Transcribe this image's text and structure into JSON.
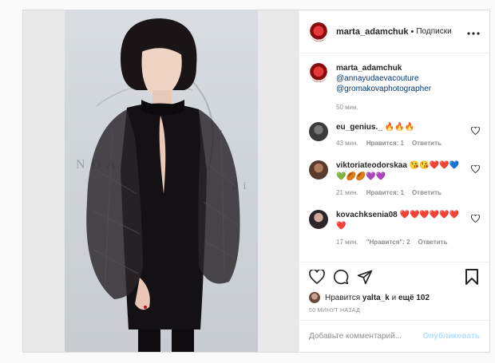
{
  "post": {
    "author": "marta_adamchuk",
    "follow_label": "Подписки",
    "header_separator": "•",
    "more_icon": "more-horizontal-icon",
    "caption": {
      "username": "marta_adamchuk",
      "mention1": "@annayudaevacouture",
      "mention2": "@gromakovaphotographer",
      "time": "50 мин."
    },
    "photo": {
      "wall_text_left": "N D A",
      "wall_text_right": "d i"
    },
    "comments": [
      {
        "username": "eu_genius._",
        "text": "🔥🔥🔥",
        "time": "43 мин.",
        "likes": "Нравится: 1",
        "reply": "Ответить"
      },
      {
        "username": "viktoriateodorskaa",
        "text": "😘😘❤️❤️💙💚🏉🏉💜💜",
        "time": "21 мин.",
        "likes": "Нравится: 1",
        "reply": "Ответить"
      },
      {
        "username": "kovachksenia08",
        "text": "❤️❤️❤️❤️❤️❤️❤️",
        "time": "17 мин.",
        "likes": "\"Нравится\": 2",
        "reply": "Ответить"
      }
    ],
    "likes": {
      "prefix": "Нравится",
      "user": "yalta_k",
      "middle": "и",
      "others": "ещё 102"
    },
    "posted_ago": "50 МИНУТ НАЗАД",
    "add_comment": {
      "placeholder": "Добавьте комментарий...",
      "post_label": "Опубликовать"
    },
    "colors": {
      "link": "#00376b",
      "muted": "#8e8e8e",
      "post_button_disabled": "#b2dffc",
      "border": "#dbdbdb"
    }
  }
}
